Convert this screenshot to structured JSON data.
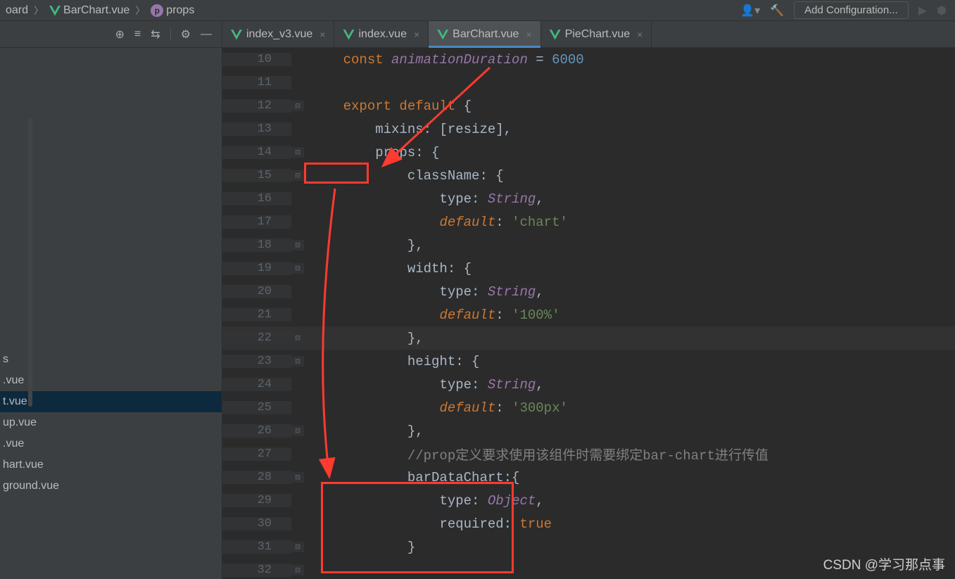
{
  "breadcrumb": {
    "item1": "oard",
    "item2": "BarChart.vue",
    "item3_icon": "p",
    "item3": "props"
  },
  "topbar": {
    "add_config": "Add Configuration..."
  },
  "tree": {
    "items": [
      {
        "label": "s"
      },
      {
        "label": ".vue"
      },
      {
        "label": "t.vue",
        "selected": true
      },
      {
        "label": "up.vue"
      },
      {
        "label": ".vue"
      },
      {
        "label": "hart.vue"
      },
      {
        "label": "ground.vue"
      }
    ]
  },
  "tabs": [
    {
      "label": "index_v3.vue",
      "active": false
    },
    {
      "label": "index.vue",
      "active": false
    },
    {
      "label": "BarChart.vue",
      "active": true
    },
    {
      "label": "PieChart.vue",
      "active": false
    }
  ],
  "code": {
    "lines": [
      {
        "n": 10,
        "segs": [
          {
            "t": "const ",
            "c": "kw"
          },
          {
            "t": "animationDuration",
            "c": "fn-it"
          },
          {
            "t": " = ",
            "c": "ident"
          },
          {
            "t": "6000",
            "c": "num"
          }
        ],
        "indent": 2
      },
      {
        "n": 11,
        "segs": [],
        "indent": 0
      },
      {
        "n": 12,
        "segs": [
          {
            "t": "export default ",
            "c": "kw"
          },
          {
            "t": "{",
            "c": "ident"
          }
        ],
        "indent": 2,
        "fold": "⊟"
      },
      {
        "n": 13,
        "segs": [
          {
            "t": "mixins",
            "c": "prop"
          },
          {
            "t": ": [",
            "c": "ident"
          },
          {
            "t": "resize",
            "c": "ident"
          },
          {
            "t": "],",
            "c": "ident"
          }
        ],
        "indent": 4
      },
      {
        "n": 14,
        "segs": [
          {
            "t": "props",
            "c": "prop"
          },
          {
            "t": ": {",
            "c": "ident"
          }
        ],
        "indent": 4,
        "fold": "⊟"
      },
      {
        "n": 15,
        "segs": [
          {
            "t": "className",
            "c": "prop"
          },
          {
            "t": ": {",
            "c": "ident"
          }
        ],
        "indent": 6,
        "fold": "⊟"
      },
      {
        "n": 16,
        "segs": [
          {
            "t": "type",
            "c": "prop"
          },
          {
            "t": ": ",
            "c": "ident"
          },
          {
            "t": "String",
            "c": "type"
          },
          {
            "t": ",",
            "c": "ident"
          }
        ],
        "indent": 8
      },
      {
        "n": 17,
        "segs": [
          {
            "t": "default",
            "c": "kw-it"
          },
          {
            "t": ": ",
            "c": "ident"
          },
          {
            "t": "'chart'",
            "c": "str"
          }
        ],
        "indent": 8
      },
      {
        "n": 18,
        "segs": [
          {
            "t": "},",
            "c": "ident"
          }
        ],
        "indent": 6,
        "fold": "⊟"
      },
      {
        "n": 19,
        "segs": [
          {
            "t": "width",
            "c": "prop"
          },
          {
            "t": ": {",
            "c": "ident"
          }
        ],
        "indent": 6,
        "fold": "⊟"
      },
      {
        "n": 20,
        "segs": [
          {
            "t": "type",
            "c": "prop"
          },
          {
            "t": ": ",
            "c": "ident"
          },
          {
            "t": "String",
            "c": "type"
          },
          {
            "t": ",",
            "c": "ident"
          }
        ],
        "indent": 8
      },
      {
        "n": 21,
        "segs": [
          {
            "t": "default",
            "c": "kw-it"
          },
          {
            "t": ": ",
            "c": "ident"
          },
          {
            "t": "'100%'",
            "c": "str"
          }
        ],
        "indent": 8
      },
      {
        "n": 22,
        "segs": [
          {
            "t": "},",
            "c": "ident"
          }
        ],
        "indent": 6,
        "fold": "⊟",
        "current": true
      },
      {
        "n": 23,
        "segs": [
          {
            "t": "height",
            "c": "prop"
          },
          {
            "t": ": {",
            "c": "ident"
          }
        ],
        "indent": 6,
        "fold": "⊟"
      },
      {
        "n": 24,
        "segs": [
          {
            "t": "type",
            "c": "prop"
          },
          {
            "t": ": ",
            "c": "ident"
          },
          {
            "t": "String",
            "c": "type"
          },
          {
            "t": ",",
            "c": "ident"
          }
        ],
        "indent": 8
      },
      {
        "n": 25,
        "segs": [
          {
            "t": "default",
            "c": "kw-it"
          },
          {
            "t": ": ",
            "c": "ident"
          },
          {
            "t": "'300px'",
            "c": "str"
          }
        ],
        "indent": 8
      },
      {
        "n": 26,
        "segs": [
          {
            "t": "},",
            "c": "ident"
          }
        ],
        "indent": 6,
        "fold": "⊟"
      },
      {
        "n": 27,
        "segs": [
          {
            "t": "//prop定义要求使用该组件时需要绑定bar-chart进行传值",
            "c": "cmt"
          }
        ],
        "indent": 6
      },
      {
        "n": 28,
        "segs": [
          {
            "t": "barDataChart",
            "c": "prop"
          },
          {
            "t": ":{",
            "c": "ident"
          }
        ],
        "indent": 6,
        "fold": "⊟"
      },
      {
        "n": 29,
        "segs": [
          {
            "t": "type",
            "c": "prop"
          },
          {
            "t": ": ",
            "c": "ident"
          },
          {
            "t": "Object",
            "c": "type"
          },
          {
            "t": ",",
            "c": "ident"
          }
        ],
        "indent": 8
      },
      {
        "n": 30,
        "segs": [
          {
            "t": "required",
            "c": "prop"
          },
          {
            "t": ": ",
            "c": "ident"
          },
          {
            "t": "true",
            "c": "kw"
          }
        ],
        "indent": 8
      },
      {
        "n": 31,
        "segs": [
          {
            "t": "}",
            "c": "ident"
          }
        ],
        "indent": 6,
        "fold": "⊟"
      },
      {
        "n": 32,
        "segs": [],
        "indent": 0,
        "fold": "⊟"
      }
    ]
  },
  "watermark": "CSDN @学习那点事"
}
